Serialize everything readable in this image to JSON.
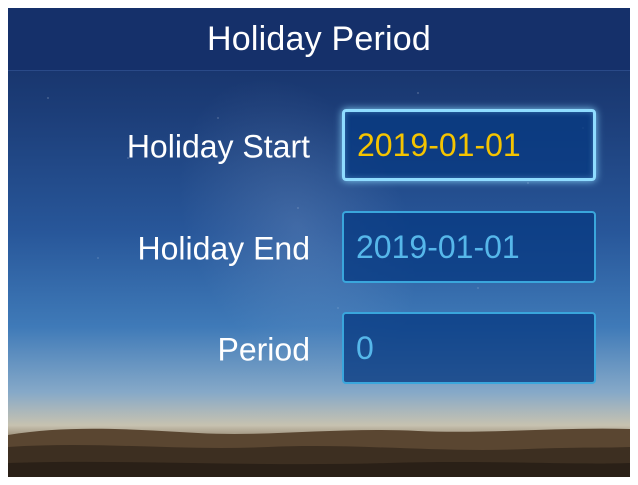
{
  "screen": {
    "title": "Holiday Period"
  },
  "form": {
    "holiday_start": {
      "label": "Holiday Start",
      "value": "2019-01-01",
      "focused": true,
      "value_color": "#f5c400"
    },
    "holiday_end": {
      "label": "Holiday End",
      "value": "2019-01-01",
      "focused": false,
      "value_color": "#56b7ea"
    },
    "period": {
      "label": "Period",
      "value": "0",
      "focused": false,
      "value_color": "#56b7ea"
    }
  },
  "colors": {
    "title_bar": "#15306a",
    "field_border": "#3aa6dc",
    "field_focus_border": "#8fdcff",
    "text": "#ffffff"
  }
}
